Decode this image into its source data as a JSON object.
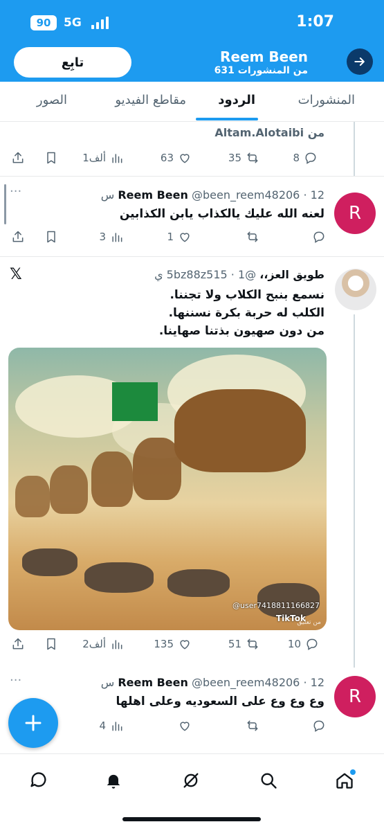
{
  "status_bar": {
    "battery": "90",
    "network": "5G",
    "time": "1:07"
  },
  "header": {
    "follow_label": "تابِع",
    "name": "Reem Been",
    "posts_count": "631 من المنشورات"
  },
  "tabs": [
    {
      "label": "المنشورات",
      "active": false
    },
    {
      "label": "الردود",
      "active": true
    },
    {
      "label": "مقاطع الفيديو",
      "active": false
    },
    {
      "label": "الصور",
      "active": false
    }
  ],
  "posts": [
    {
      "context": "من Altam.Alotaibi",
      "replies": "8",
      "reposts": "35",
      "likes": "63",
      "views": "1ألف"
    },
    {
      "avatar_letter": "R",
      "name": "Reem Been",
      "handle": "@been_reem48206",
      "time": "12 س",
      "text": "لعنه الله عليك يالكذاب يابن الكذابين",
      "replies": "",
      "reposts": "",
      "likes": "1",
      "views": "3"
    },
    {
      "name": "طويق العز،،",
      "handle": "@5bz88z515",
      "time": "1 ي",
      "text_lines": [
        "نسمع بنبح الكلاب ولا تجننا.",
        "الكلب له حربة بكرة نسننها.",
        "من دون صهيون بذتنا صهاينا."
      ],
      "media_watermark_user": "@user7418811166827",
      "media_watermark_brand": "TikTok",
      "media_watermark_sub": "من تعليق",
      "replies": "10",
      "reposts": "51",
      "likes": "135",
      "views": "2ألف"
    },
    {
      "avatar_letter": "R",
      "name": "Reem Been",
      "handle": "@been_reem48206",
      "time": "12 س",
      "text": "وع وع وع على السعوديه وعلى اهلها",
      "replies": "",
      "reposts": "",
      "likes": "",
      "views": "4"
    }
  ],
  "colors": {
    "accent": "#1d9bf0",
    "avatar": "#cf1f5f",
    "muted": "#536471"
  },
  "icons": [
    "arrow-right-icon",
    "reply-icon",
    "repost-icon",
    "like-icon",
    "views-icon",
    "bookmark-icon",
    "share-icon",
    "x-logo-icon",
    "more-icon",
    "plus-icon",
    "messages-icon",
    "notifications-icon",
    "grok-icon",
    "search-icon",
    "home-icon"
  ]
}
